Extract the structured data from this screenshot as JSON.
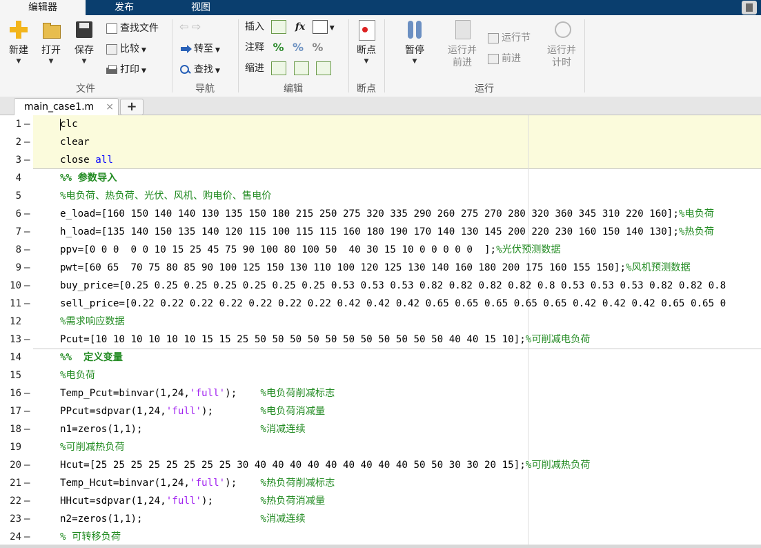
{
  "tabs": [
    "编辑器",
    "发布",
    "视图"
  ],
  "ribbon": {
    "file": {
      "label": "文件",
      "new": "新建",
      "open": "打开",
      "save": "保存",
      "find_files": "查找文件",
      "compare": "比较",
      "print": "打印"
    },
    "nav": {
      "label": "导航",
      "goto": "转至",
      "find": "查找"
    },
    "edit": {
      "label": "编辑",
      "insert": "插入",
      "comment": "注释",
      "indent": "缩进",
      "fx": "fx"
    },
    "breakpoints": {
      "label": "断点",
      "btn": "断点"
    },
    "run": {
      "label": "运行",
      "pause": "暂停",
      "run_advance_1": "运行并",
      "run_advance_2": "前进",
      "run_section": "运行节",
      "advance": "前进",
      "run_time_1": "运行并",
      "run_time_2": "计时"
    }
  },
  "doc_tab": {
    "name": "main_case1.m",
    "close": "×",
    "add": "+"
  },
  "editor": {
    "lines": [
      {
        "n": "1",
        "mark": "—",
        "code": "clc"
      },
      {
        "n": "2",
        "mark": "—",
        "code": "clear"
      },
      {
        "n": "3",
        "mark": "—",
        "code": "close all"
      },
      {
        "n": "4",
        "mark": "",
        "code": "%% 参数导入"
      },
      {
        "n": "5",
        "mark": "",
        "code": "%电负荷、热负荷、光伏、风机、购电价、售电价"
      },
      {
        "n": "6",
        "mark": "—",
        "code": "e_load=[160 150 140 140 130 135 150 180 215 250 275 320 335 290 260 275 270 280 320 360 345 310 220 160];%电负荷"
      },
      {
        "n": "7",
        "mark": "—",
        "code": "h_load=[135 140 150 135 140 120 115 100 115 115 160 180 190 170 140 130 145 200 220 230 160 150 140 130];%热负荷"
      },
      {
        "n": "8",
        "mark": "—",
        "code": "ppv=[0 0 0  0 0 10 15 25 45 75 90 100 80 100 50  40 30 15 10 0 0 0 0 0  ];%光伏预测数据"
      },
      {
        "n": "9",
        "mark": "—",
        "code": "pwt=[60 65  70 75 80 85 90 100 125 150 130 110 100 120 125 130 140 160 180 200 175 160 155 150];%风机预测数据"
      },
      {
        "n": "10",
        "mark": "—",
        "code": "buy_price=[0.25 0.25 0.25 0.25 0.25 0.25 0.25 0.53 0.53 0.53 0.82 0.82 0.82 0.82 0.8 0.53 0.53 0.53 0.82 0.82 0.8"
      },
      {
        "n": "11",
        "mark": "—",
        "code": "sell_price=[0.22 0.22 0.22 0.22 0.22 0.22 0.22 0.42 0.42 0.42 0.65 0.65 0.65 0.65 0.65 0.42 0.42 0.42 0.65 0.65 0"
      },
      {
        "n": "12",
        "mark": "",
        "code": "%需求响应数据"
      },
      {
        "n": "13",
        "mark": "—",
        "code": "Pcut=[10 10 10 10 10 10 15 15 25 50 50 50 50 50 50 50 50 50 50 50 40 40 15 10];%可削减电负荷"
      },
      {
        "n": "14",
        "mark": "",
        "code": "%%  定义变量"
      },
      {
        "n": "15",
        "mark": "",
        "code": "%电负荷"
      },
      {
        "n": "16",
        "mark": "—",
        "code": "Temp_Pcut=binvar(1,24,'full');    %电负荷削减标志"
      },
      {
        "n": "17",
        "mark": "—",
        "code": "PPcut=sdpvar(1,24,'full');        %电负荷消减量"
      },
      {
        "n": "18",
        "mark": "—",
        "code": "n1=zeros(1,1);                    %消减连续"
      },
      {
        "n": "19",
        "mark": "",
        "code": "%可削减热负荷"
      },
      {
        "n": "20",
        "mark": "—",
        "code": "Hcut=[25 25 25 25 25 25 25 25 30 40 40 40 40 40 40 40 40 40 50 50 30 30 20 15];%可削减热负荷"
      },
      {
        "n": "21",
        "mark": "—",
        "code": "Temp_Hcut=binvar(1,24,'full');    %热负荷削减标志"
      },
      {
        "n": "22",
        "mark": "—",
        "code": "HHcut=sdpvar(1,24,'full');        %热负荷消减量"
      },
      {
        "n": "23",
        "mark": "—",
        "code": "n2=zeros(1,1);                    %消减连续"
      },
      {
        "n": "24",
        "mark": "—",
        "code": "% 可转移负荷"
      }
    ]
  },
  "colors": {
    "keyword": "#0000ff",
    "string": "#a020f0",
    "comment": "#228b22",
    "tabbar": "#0a3e6e",
    "cell_highlight": "#fbfbdc"
  },
  "icons": [
    "new-icon",
    "open-icon",
    "save-icon",
    "find-files-icon",
    "compare-icon",
    "print-icon",
    "back-icon",
    "forward-icon",
    "goto-icon",
    "find-icon",
    "insert-icon",
    "fx-icon",
    "comment-icon",
    "indent-icon",
    "breakpoint-icon",
    "pause-icon",
    "run-advance-icon",
    "run-section-icon",
    "advance-icon",
    "run-time-icon"
  ]
}
